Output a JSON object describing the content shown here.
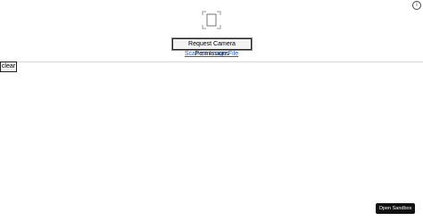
{
  "info": {
    "glyph": "i",
    "icon_name": "info-icon"
  },
  "scanner": {
    "frame_icon_name": "camera-viewfinder-icon",
    "request_button_label": "Request Camera Permissions",
    "scan_image_link_label": "Scan an Image File",
    "link_color": "#1a5fd6"
  },
  "controls": {
    "clear_button_label": "clear"
  },
  "sandbox": {
    "open_button_label": "Open Sandbox",
    "button_color": "#111111"
  }
}
